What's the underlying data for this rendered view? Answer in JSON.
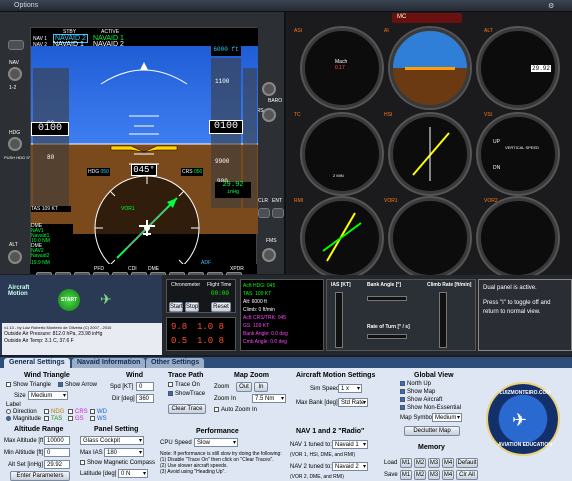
{
  "menu": {
    "options": "Options"
  },
  "pfd": {
    "stby_label": "STBY",
    "active_label": "ACTIVE",
    "nav1_label": "NAV 1",
    "nav2_label": "NAV 2",
    "nav1_stby": "NAVAID 2",
    "nav1_active": "NAVAID 1",
    "nav2_stby": "NAVAID 1",
    "nav2_active": "NAVAID 2",
    "alt_bug": "6000 ft",
    "alt_top": "1100",
    "alt_main": "0100",
    "alt_low": "9900",
    "alt_900": "900",
    "vs_bug": "0 ft/min",
    "ias": "0100",
    "ias_90": "90",
    "ias_80": "80",
    "tas": "TAS 109 KT",
    "oat": "OAT 31°C",
    "hdg_label": "HDG",
    "hdg_val": "050",
    "crs_label": "CRS",
    "crs_val": "050",
    "heading": "045°",
    "baro": "29.92",
    "baro_unit": "inHg",
    "dme1": "DME",
    "nav1_dme": "NAV1",
    "navaid1": "Navaid1",
    "dist1": "10.0 NM",
    "dme2": "DME",
    "nav2_dme": "NAV2",
    "navaid2": "Navaid2",
    "dist2": "19.9 NM",
    "vor1": "VOR1",
    "gps": "GPS",
    "adf": "ADF",
    "softkeys": [
      "PFD",
      "CDI",
      "DME"
    ],
    "xpdr": "XPDR",
    "nav_softlabel": "NAV",
    "nav_12": "1-2",
    "hdg_btn": "HDG",
    "push": "PUSH",
    "hdg_sync": "PUSH HDG SYNC",
    "alt_btn": "ALT",
    "baro_btn": "BARO",
    "crs_btn": "CRS",
    "clr_btn": "CLR",
    "ent_btn": "ENT",
    "fms_btn": "FMS",
    "nav2_small": "NAV 2"
  },
  "gauges": {
    "asi": "ASI",
    "ai": "AI",
    "alt": "ALT",
    "tc": "TC",
    "hsi": "HSI",
    "vsi": "VSI",
    "rmi": "RMI",
    "vor1": "VOR1",
    "vor2": "VOR2",
    "mach": "Mach",
    "mach_val": "0.17",
    "alt_kollsman": "29.92",
    "vs_label": "VERTICAL SPEED",
    "vs_units": "100 FEET PER MIN",
    "up": "UP",
    "dn": "DN",
    "two_min": "2 MIN",
    "turn_coord": "TURN COORDINATOR",
    "warn_text": "MC",
    "nav_flag": "NAV"
  },
  "aircraft_motion": {
    "title": "Aircraft Motion",
    "start": "START",
    "version": "v1.13 - by Luiz Roberto Monteiro de Oliveira (C) 2007 - 2010",
    "press": "Outside Air Pressure: 812.0 hPa, 23.98 inHg",
    "temp": "Outside Air Temp: 3.1 C, 37.6 F"
  },
  "chrono": {
    "title": "Chronometer",
    "start": "Start",
    "stop": "Stop",
    "ft_title": "Flight Time",
    "ft_val": "00:00",
    "reset": "Reset"
  },
  "readout": {
    "n1": "9.8",
    "n2": "1.0 8",
    "n3": "0.5",
    "n4": "1.0 8",
    "nav1": "NAV 1",
    "nav2": "NAV 2"
  },
  "flightinfo": {
    "l1": "Acft HDG: 045",
    "l2": "TAS: 109 KT",
    "l3": "Alt: 6000 ft",
    "l4": "Climb: 0 ft/min",
    "l5": "Acft CRS/TRK: 045",
    "l6": "GS: 109 KT",
    "l7": "Bank Angle: 0.0 deg",
    "l8": "Cmb Angle: 0.0 deg"
  },
  "ias_chart": {
    "title": "IAS [KT]",
    "bank": "Bank Angle [°]",
    "climb": "Climb Rate [ft/min]",
    "rot": "Rate of Turn [° / s]"
  },
  "dual": {
    "line1": "Dual panel is active.",
    "line2": "Press \"I\" to toggle off and return to normal view."
  },
  "tabs": [
    "General Settings",
    "Navaid Information",
    "Other Settings"
  ],
  "wind_triangle": {
    "title": "Wind Triangle",
    "show_triangle": "Show Triangle",
    "show_arrow": "Show Arrow",
    "size_label": "Size",
    "size": "Medium",
    "label": "Label",
    "direction": "Direction",
    "ndg": "NDG",
    "crs": "CRS",
    "wd": "WD",
    "magnitude": "Magnitude",
    "tas": "TAS",
    "gs": "GS",
    "ws": "WS"
  },
  "wind": {
    "title": "Wind",
    "spd_label": "Spd [KT]",
    "spd": "0",
    "dir_label": "Dir [deg]",
    "dir": "360"
  },
  "trace": {
    "title": "Trace Path",
    "trace_on": "Trace On",
    "show_trace": "ShowTrace",
    "clear": "Clear Trace"
  },
  "map_zoom": {
    "title": "Map Zoom",
    "zoom": "Zoom",
    "out": "Out",
    "in": "In",
    "zoom_in_label": "Zoom In",
    "zoom_in": "7.5 Nm",
    "auto": "Auto Zoom In"
  },
  "motion_settings": {
    "title": "Aircraft Motion Settings",
    "sim_speed_label": "Sim Speed",
    "sim_speed": "1 x",
    "max_bank_label": "Max Bank [deg]",
    "max_bank": "Std Rate"
  },
  "global_view": {
    "title": "Global View",
    "north_up": "North Up",
    "show_map": "Show Map",
    "show_aircraft": "Show Aircraft",
    "show_nonessential": "Show Non-Essential",
    "map_symbols_label": "Map Symbols",
    "map_symbols": "Medium",
    "declutter": "Declutter Map"
  },
  "alt_range": {
    "title": "Altitude Range",
    "max_label": "Max Altitude [ft]",
    "max": "10000",
    "min_label": "Min Altitude [ft]",
    "min": "0",
    "alt_set_label": "Alt Set [inHg]",
    "alt_set": "29.92",
    "enter": "Enter Parameters"
  },
  "panel_setting": {
    "title": "Panel Setting",
    "panel": "Glass Cockpit",
    "max_ias_label": "Max IAS",
    "max_ias": "180",
    "show_compass": "Show Magnetic Compass",
    "latitude_label": "Latitude [deg]",
    "latitude": "0 N"
  },
  "performance": {
    "title": "Performance",
    "cpu_label": "CPU Speed",
    "cpu": "Slow",
    "note_title": "Note: If performance is still slow try doing the following:",
    "note1": "(1) Disable \"Trace On\" then click on \"Clear Traces\".",
    "note2": "(2) Use slower aircraft speeds.",
    "note3": "(3) Avoid using \"Heading Up\"."
  },
  "nav_radio": {
    "title": "NAV 1 and 2 \"Radio\"",
    "nav1_label": "NAV 1 tuned to:",
    "nav1": "Navaid 1",
    "nav1_note": "(VOR 1, HSI, DME, and RMI)",
    "nav2_label": "NAV 2 tuned to:",
    "nav2": "Navaid 2",
    "nav2_note": "(VOR 2, DME, and RMI)"
  },
  "memory": {
    "title": "Memory",
    "load": "Load",
    "save": "Save",
    "slots": [
      "M1",
      "M2",
      "M3",
      "M4",
      "Default"
    ],
    "slots2": [
      "M1",
      "M2",
      "M3",
      "M4",
      "Clr All"
    ]
  },
  "logo": {
    "top": "LUIZMONTEIRO.COM",
    "bottom": "AVIATION EDUCATION"
  },
  "colors": {
    "sky": "#2e6fe6",
    "ground": "#7a4a1c",
    "magenta": "#ff40ff",
    "cyan": "#33ccff",
    "green": "#00ff40",
    "orange": "#ff7a1a",
    "panel": "#dde6f2"
  }
}
